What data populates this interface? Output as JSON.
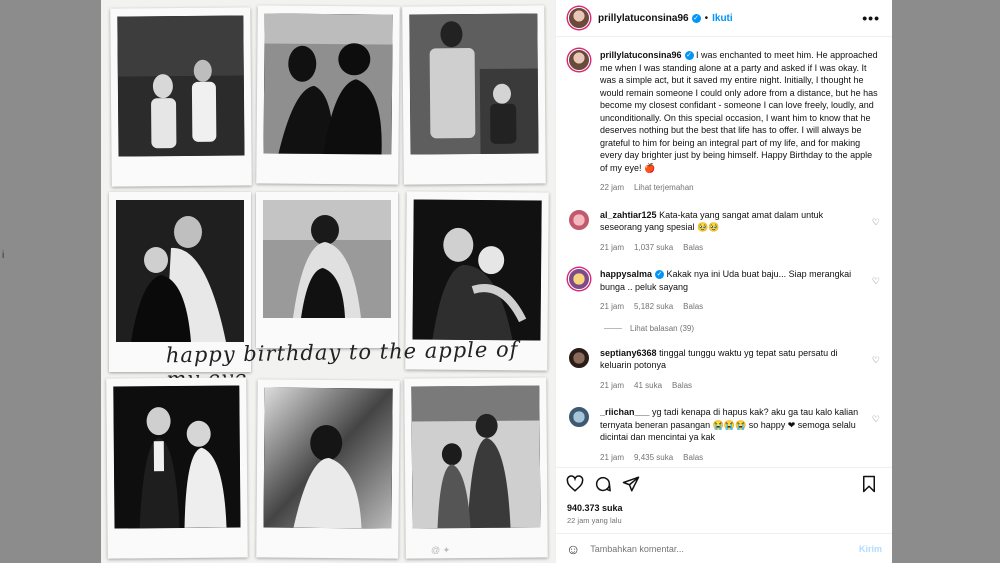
{
  "side_text": "i",
  "post": {
    "username": "prillylatuconsina96",
    "follow_label": "Ikuti",
    "more_label": "•••",
    "caption": "I was enchanted to meet him. He approached me when I was standing alone at a party and asked if I was okay. It was a simple act, but it saved my entire night. Initially, I thought he would remain someone I could only adore from a distance, but he has become my closest confidant - someone I can love freely, loudly, and unconditionally. On this special occasion, I want him to know that he deserves nothing but the best that life has to offer. I will always be grateful to him for being an integral part of my life, and for making every day brighter just by being himself. Happy Birthday to the apple of my eye! 🍎",
    "caption_time": "22 jam",
    "translate_label": "Lihat terjemahan",
    "script_text": "happy birthday to the apple of my eye"
  },
  "comments": [
    {
      "username": "al_zahtiar125",
      "verified": false,
      "text": "Kata-kata yang sangat amat dalam untuk seseorang yang spesial 🥹🥹",
      "time": "21 jam",
      "likes": "1,037 suka",
      "reply": "Balas"
    },
    {
      "username": "happysalma",
      "verified": true,
      "text": "Kakak nya ini Uda buat baju... Siap merangkai bunga .. peluk sayang",
      "time": "21 jam",
      "likes": "5,182 suka",
      "reply": "Balas",
      "view_replies": "Lihat balasan (39)"
    },
    {
      "username": "septiany6368",
      "verified": false,
      "text": "tinggal tunggu waktu yg tepat satu persatu di keluarin potonya",
      "time": "21 jam",
      "likes": "41 suka",
      "reply": "Balas"
    },
    {
      "username": "_riichan___",
      "verified": false,
      "text": "yg tadi kenapa di hapus kak? aku ga tau kalo kalian ternyata beneran pasangan 😭😭😭 so happy ❤ semoga selalu dicintai dan mencintai ya kak",
      "time": "21 jam",
      "likes": "9,435 suka",
      "reply": "Balas"
    }
  ],
  "footer": {
    "likes": "940.373 suka",
    "time": "22 jam yang lalu",
    "comment_placeholder": "Tambahkan komentar...",
    "post_label": "Kirim"
  },
  "icons": [
    "heart-icon",
    "comment-icon",
    "share-icon",
    "bookmark-icon",
    "emoji-icon",
    "verified-icon",
    "more-icon"
  ],
  "colors": {
    "accent": "#0095f6",
    "text": "#111111",
    "muted": "#737373",
    "photo_dark": "#1a1a1a"
  }
}
